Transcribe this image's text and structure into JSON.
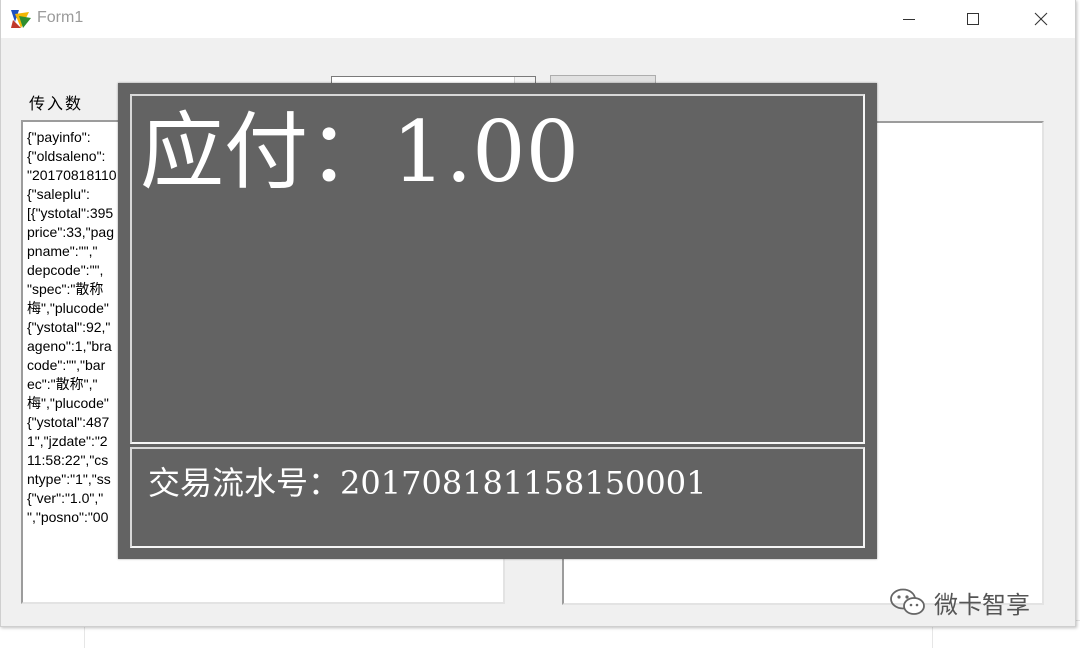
{
  "window": {
    "title": "Form1"
  },
  "form": {
    "input_label": "传入数",
    "input_json_lines": [
      "{\"payinfo\":",
      "{\"oldsaleno\":",
      "\"20170818110",
      "{\"saleplu\":",
      "[{\"ystotal\":395",
      "price\":33,\"pag",
      "pname\":\"\",\"",
      "depcode\":\"\",",
      "\"spec\":\"散称",
      "梅\",\"plucode\"",
      "{\"ystotal\":92,\"",
      "ageno\":1,\"bra",
      "code\":\"\",\"bar",
      "ec\":\"散称\",\"",
      "梅\",\"plucode\"",
      "{\"ystotal\":487",
      "1\",\"jzdate\":\"2",
      "11:58:22\",\"cs",
      "ntype\":\"1\",\"ss",
      "{\"ver\":\"1.0\",\"",
      "\",\"posno\":\"00"
    ]
  },
  "payment_dialog": {
    "amount_label": "应付：",
    "amount_value": "1.00",
    "serial_label": "交易流水号：",
    "serial_value": "20170818115815000​1"
  },
  "watermark": {
    "text": "微卡智享"
  },
  "colors": {
    "dialog_bg": "#636363",
    "window_bg": "#f0f0f0",
    "text_white": "#ffffff"
  }
}
